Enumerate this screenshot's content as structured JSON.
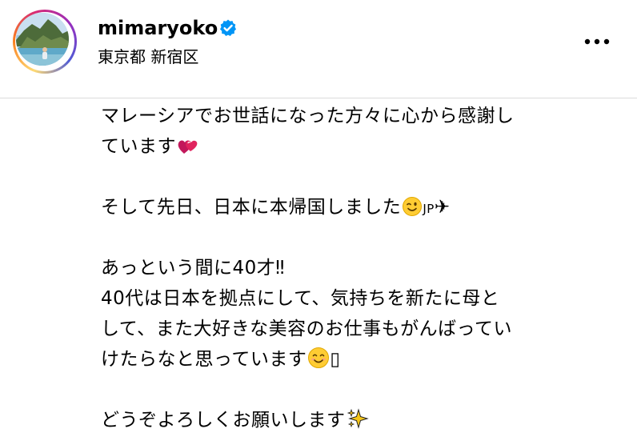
{
  "post": {
    "username": "mimaryoko",
    "location": "東京都 新宿区",
    "verified": true,
    "icons": {
      "avatar": "avatar-photo",
      "verified": "verified-badge-icon",
      "more": "more-options-icon"
    }
  },
  "caption": {
    "line1": "マレーシアでお世話になった方々に心から感謝し",
    "line2": "ています",
    "line3": "そして先日、日本に本帰国しました",
    "line3_flag": "JP",
    "line3_plane": "✈",
    "line4": "あっという間に40才‼",
    "line5": "40代は日本を拠点にして、気持ちを新たに母と",
    "line6": "して、また大好きな美容のお仕事もがんばってい",
    "line7": "けたらなと思っています",
    "line7_trailing": "▯",
    "line8": "どうぞよろしくお願いします"
  },
  "colors": {
    "verified": "#0095f6",
    "ring_start": "#feda75",
    "ring_mid": "#d62976",
    "ring_end": "#4f5bd5",
    "divider": "#dbdbdb",
    "heart": "#e0245e",
    "smile": "#ffcc33",
    "sparkle": "#f5c518"
  }
}
